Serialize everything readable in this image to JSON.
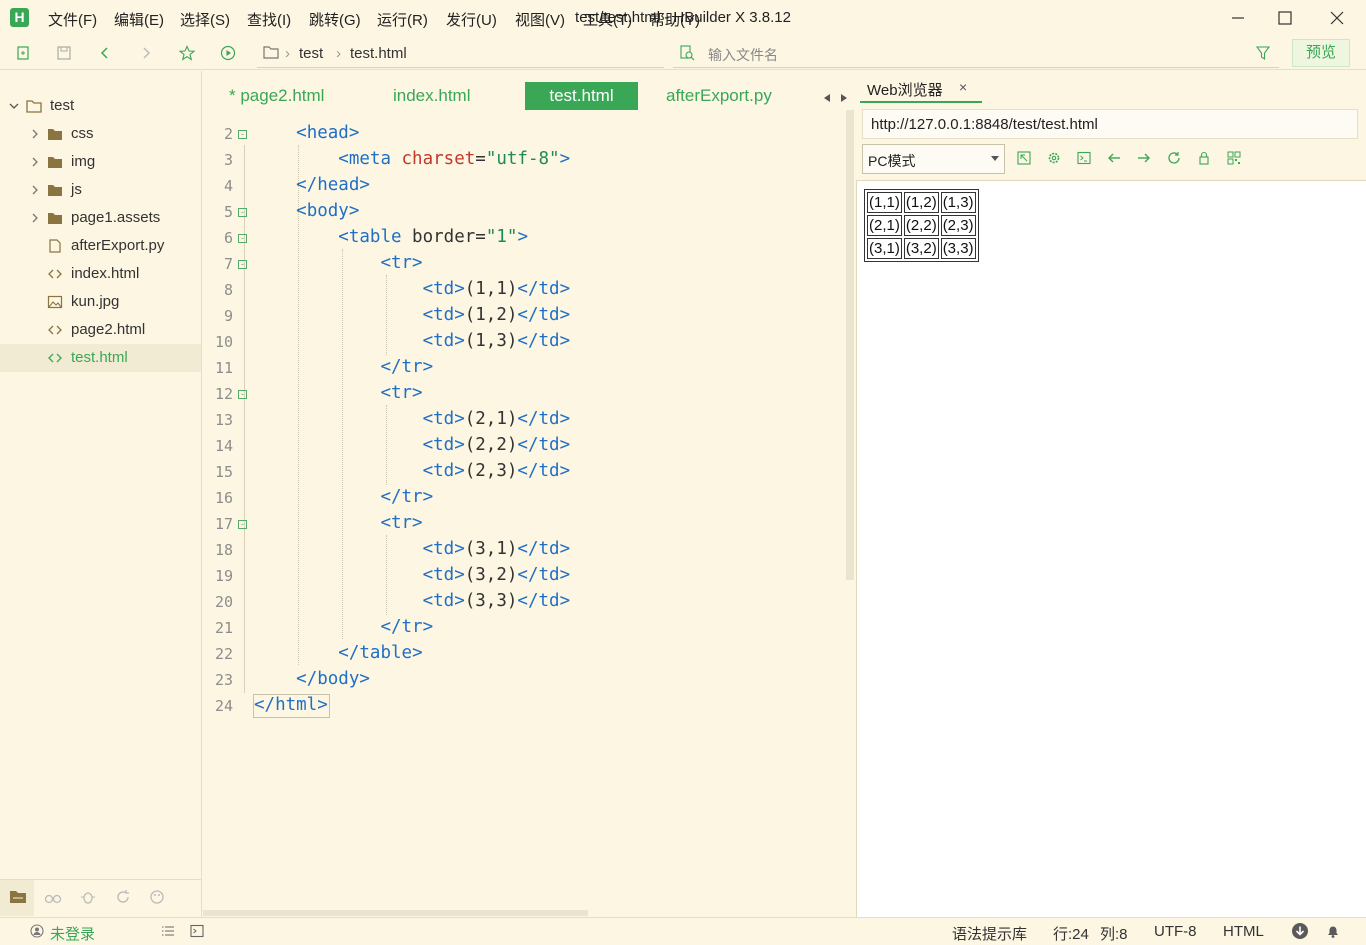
{
  "app": {
    "logo_letter": "H",
    "window_title": "test/test.html - HBuilder X 3.8.12"
  },
  "menu": [
    "文件(F)",
    "编辑(E)",
    "选择(S)",
    "查找(I)",
    "跳转(G)",
    "运行(R)",
    "发行(U)",
    "视图(V)",
    "工具(T)",
    "帮助(Y)"
  ],
  "toolbar": {
    "breadcrumb": [
      "test",
      "test.html"
    ],
    "file_search_placeholder": "输入文件名",
    "preview_label": "预览"
  },
  "sidebar": {
    "project": "test",
    "items": [
      {
        "label": "css",
        "type": "folder"
      },
      {
        "label": "img",
        "type": "folder"
      },
      {
        "label": "js",
        "type": "folder"
      },
      {
        "label": "page1.assets",
        "type": "folder"
      },
      {
        "label": "afterExport.py",
        "type": "file"
      },
      {
        "label": "index.html",
        "type": "html"
      },
      {
        "label": "kun.jpg",
        "type": "image"
      },
      {
        "label": "page2.html",
        "type": "html"
      },
      {
        "label": "test.html",
        "type": "html",
        "selected": true
      }
    ]
  },
  "editor": {
    "tabs": [
      "* page2.html",
      "index.html",
      "test.html",
      "afterExport.py"
    ],
    "active_tab": "test.html",
    "line_numbers": [
      "2",
      "3",
      "4",
      "5",
      "6",
      "7",
      "8",
      "9",
      "10",
      "11",
      "12",
      "13",
      "14",
      "15",
      "16",
      "17",
      "18",
      "19",
      "20",
      "21",
      "22",
      "23",
      "24"
    ],
    "lines": [
      "<head>",
      "<meta charset=\"utf-8\">",
      "</head>",
      "<body>",
      "<table border=\"1\">",
      "<tr>",
      "<td>(1,1)</td>",
      "<td>(1,2)</td>",
      "<td>(1,3)</td>",
      "</tr>",
      "<tr>",
      "<td>(2,1)</td>",
      "<td>(2,2)</td>",
      "<td>(2,3)</td>",
      "</tr>",
      "<tr>",
      "<td>(3,1)</td>",
      "<td>(3,2)</td>",
      "<td>(3,3)</td>",
      "</tr>",
      "</table>",
      "</body>",
      "</html>"
    ]
  },
  "browser": {
    "tab_label": "Web浏览器",
    "close_glyph": "×",
    "url": "http://127.0.0.1:8848/test/test.html",
    "mode": "PC模式",
    "table": [
      [
        "(1,1)",
        "(1,2)",
        "(1,3)"
      ],
      [
        "(2,1)",
        "(2,2)",
        "(2,3)"
      ],
      [
        "(3,1)",
        "(3,2)",
        "(3,3)"
      ]
    ]
  },
  "status": {
    "login": "未登录",
    "syntax_lib": "语法提示库",
    "row": "行:24",
    "col": "列:8",
    "encoding": "UTF-8",
    "language": "HTML"
  },
  "colors": {
    "accent": "#3aa757",
    "background": "#fcf6e3",
    "tag": "#1f6fc7",
    "attribute": "#c0392b",
    "string": "#1d8b57"
  }
}
